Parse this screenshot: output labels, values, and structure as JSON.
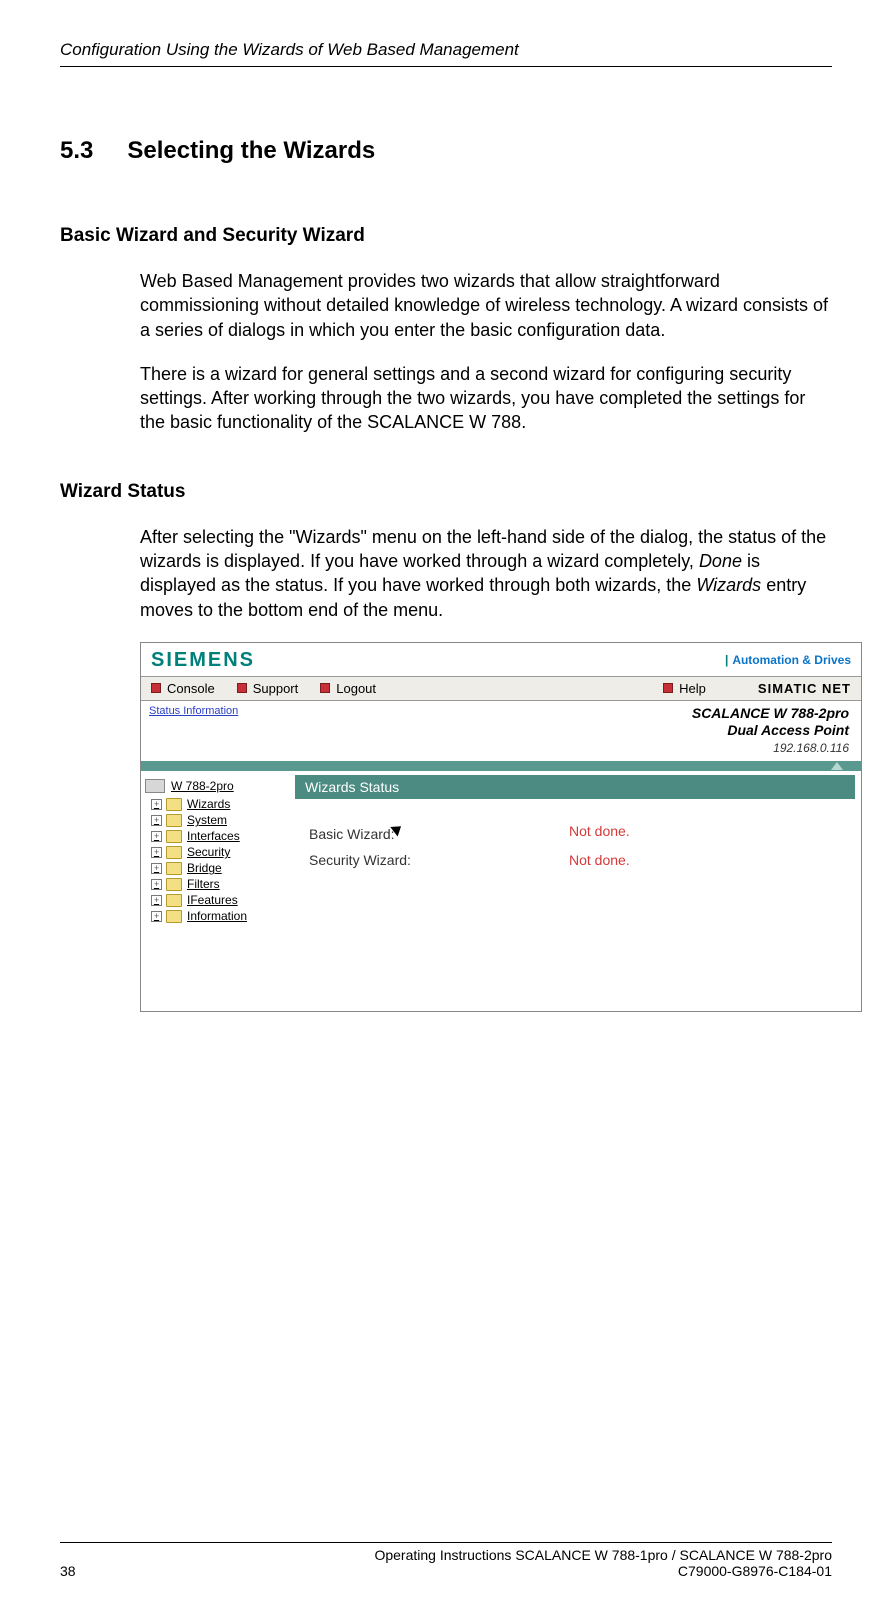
{
  "running_head": "Configuration Using the Wizards of Web Based Management",
  "section": {
    "number": "5.3",
    "title": "Selecting the Wizards"
  },
  "sub1": {
    "heading": "Basic Wizard and Security Wizard",
    "para1": "Web Based Management provides two wizards that allow straightforward commissioning without detailed knowledge of wireless technology. A wizard consists of a series of dialogs in which you enter the basic configuration data.",
    "para2": "There is a wizard for general settings and a second wizard for configuring security settings. After working through the two wizards, you have completed the settings for the basic functionality of the SCALANCE W 788."
  },
  "sub2": {
    "heading": "Wizard Status",
    "para1_a": "After selecting the \"Wizards\" menu on the left-hand side of the dialog, the status of the wizards is displayed. If you have worked through a wizard completely, ",
    "para1_done": "Done",
    "para1_b": " is displayed as the status. If you have worked through both wizards, the ",
    "para1_wiz": "Wizards",
    "para1_c": " entry moves to the bottom end of the menu."
  },
  "screenshot": {
    "logo": "SIEMENS",
    "ad_link": "Automation & Drives",
    "menu": {
      "console": "Console",
      "support": "Support",
      "logout": "Logout",
      "help": "Help",
      "simatic": "SIMATIC NET"
    },
    "status_link": "Status Information",
    "device": {
      "line1": "SCALANCE W 788-2pro",
      "line2": "Dual Access Point",
      "ip": "192.168.0.116"
    },
    "tree": {
      "root": "W 788-2pro",
      "items": [
        "Wizards",
        "System",
        "Interfaces",
        "Security",
        "Bridge",
        "Filters",
        "IFeatures",
        "Information"
      ]
    },
    "panel_title": "Wizards Status",
    "rows": [
      {
        "label": "Basic Wizard:",
        "status": "Not done."
      },
      {
        "label": "Security Wizard:",
        "status": "Not done."
      }
    ]
  },
  "footer": {
    "page_no": "38",
    "line1": "Operating Instructions SCALANCE W 788-1pro / SCALANCE W 788-2pro",
    "line2": "C79000-G8976-C184-01"
  }
}
